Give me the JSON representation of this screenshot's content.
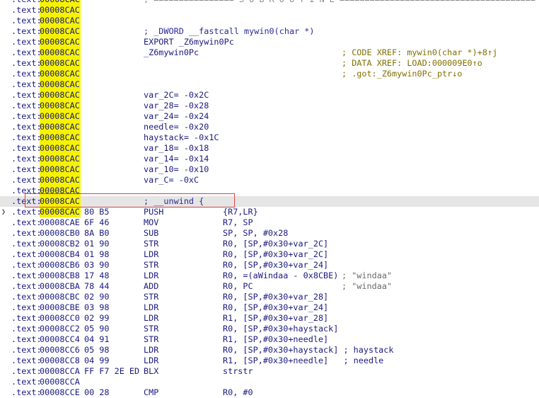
{
  "lines": [
    {
      "seg": ".text:",
      "addr": "00008CAC",
      "hl": true,
      "cmt": "; ================ S U B R O U T I N E =======================================",
      "cmt_gray": true
    },
    {
      "seg": ".text:",
      "addr": "00008CAC",
      "hl": true
    },
    {
      "seg": ".text:",
      "addr": "00008CAC",
      "hl": true
    },
    {
      "seg": ".text:",
      "addr": "00008CAC",
      "hl": true,
      "cmt": "; _DWORD __fastcall mywin0(char *)"
    },
    {
      "seg": ".text:",
      "addr": "00008CAC",
      "hl": true,
      "mnem": "EXPORT _Z6mywin0Pc"
    },
    {
      "seg": ".text:",
      "addr": "00008CAC",
      "hl": true,
      "mnem": "_Z6mywin0Pc",
      "xref": "; CODE XREF: mywin0(char *)+8↑j"
    },
    {
      "seg": ".text:",
      "addr": "00008CAC",
      "hl": true,
      "xref": "; DATA XREF: LOAD:000009E0↑o"
    },
    {
      "seg": ".text:",
      "addr": "00008CAC",
      "hl": true,
      "xref": "; .got:_Z6mywin0Pc_ptr↓o"
    },
    {
      "seg": ".text:",
      "addr": "00008CAC",
      "hl": true
    },
    {
      "seg": ".text:",
      "addr": "00008CAC",
      "hl": true,
      "mnem": "var_2C= -0x2C"
    },
    {
      "seg": ".text:",
      "addr": "00008CAC",
      "hl": true,
      "mnem": "var_28= -0x28"
    },
    {
      "seg": ".text:",
      "addr": "00008CAC",
      "hl": true,
      "mnem": "var_24= -0x24"
    },
    {
      "seg": ".text:",
      "addr": "00008CAC",
      "hl": true,
      "mnem": "needle= -0x20"
    },
    {
      "seg": ".text:",
      "addr": "00008CAC",
      "hl": true,
      "mnem": "haystack= -0x1C"
    },
    {
      "seg": ".text:",
      "addr": "00008CAC",
      "hl": true,
      "mnem": "var_18= -0x18"
    },
    {
      "seg": ".text:",
      "addr": "00008CAC",
      "hl": true,
      "mnem": "var_14= -0x14"
    },
    {
      "seg": ".text:",
      "addr": "00008CAC",
      "hl": true,
      "mnem": "var_10= -0x10"
    },
    {
      "seg": ".text:",
      "addr": "00008CAC",
      "hl": true,
      "mnem": "var_C= -0xC"
    },
    {
      "seg": ".text:",
      "addr": "00008CAC",
      "hl": true
    },
    {
      "seg": ".text:",
      "addr": "00008CAC",
      "hl": true,
      "cmt": "; __unwind {",
      "sel": true
    },
    {
      "seg": ".text:",
      "addr": "00008CAC",
      "hl": true,
      "bytes": "80 B5",
      "mnem": "PUSH",
      "ops": "{R7,LR}",
      "chev": true
    },
    {
      "seg": ".text:",
      "addr": "00008CAE",
      "bytes": "6F 46",
      "mnem": "MOV",
      "ops": "R7, SP"
    },
    {
      "seg": ".text:",
      "addr": "00008CB0",
      "bytes": "8A B0",
      "mnem": "SUB",
      "ops": "SP, SP, #0x28"
    },
    {
      "seg": ".text:",
      "addr": "00008CB2",
      "bytes": "01 90",
      "mnem": "STR",
      "ops": "R0, [SP,#0x30+var_2C]"
    },
    {
      "seg": ".text:",
      "addr": "00008CB4",
      "bytes": "01 98",
      "mnem": "LDR",
      "ops": "R0, [SP,#0x30+var_2C]"
    },
    {
      "seg": ".text:",
      "addr": "00008CB6",
      "bytes": "03 90",
      "mnem": "STR",
      "ops": "R0, [SP,#0x30+var_24]"
    },
    {
      "seg": ".text:",
      "addr": "00008CB8",
      "bytes": "17 48",
      "mnem": "LDR",
      "ops": "R0, =(aWindaa - 0x8CBE)",
      "str": "; \"windaa\""
    },
    {
      "seg": ".text:",
      "addr": "00008CBA",
      "bytes": "78 44",
      "mnem": "ADD",
      "ops": "R0, PC",
      "str": "; \"windaa\""
    },
    {
      "seg": ".text:",
      "addr": "00008CBC",
      "bytes": "02 90",
      "mnem": "STR",
      "ops": "R0, [SP,#0x30+var_28]"
    },
    {
      "seg": ".text:",
      "addr": "00008CBE",
      "bytes": "03 98",
      "mnem": "LDR",
      "ops": "R0, [SP,#0x30+var_24]"
    },
    {
      "seg": ".text:",
      "addr": "00008CC0",
      "bytes": "02 99",
      "mnem": "LDR",
      "ops": "R1, [SP,#0x30+var_28]"
    },
    {
      "seg": ".text:",
      "addr": "00008CC2",
      "bytes": "05 90",
      "mnem": "STR",
      "ops": "R0, [SP,#0x30+haystack]"
    },
    {
      "seg": ".text:",
      "addr": "00008CC4",
      "bytes": "04 91",
      "mnem": "STR",
      "ops": "R1, [SP,#0x30+needle]"
    },
    {
      "seg": ".text:",
      "addr": "00008CC6",
      "bytes": "05 98",
      "mnem": "LDR",
      "ops": "R0, [SP,#0x30+haystack] ; haystack"
    },
    {
      "seg": ".text:",
      "addr": "00008CC8",
      "bytes": "04 99",
      "mnem": "LDR",
      "ops": "R1, [SP,#0x30+needle]   ; needle"
    },
    {
      "seg": ".text:",
      "addr": "00008CCA",
      "bytes": "FF F7 2E ED",
      "mnem": "BLX",
      "ops": "strstr"
    },
    {
      "seg": ".text:",
      "addr": "00008CCA"
    },
    {
      "seg": ".text:",
      "addr": "00008CCE",
      "bytes": "00 28",
      "mnem": "CMP",
      "ops": "R0, #0"
    }
  ]
}
